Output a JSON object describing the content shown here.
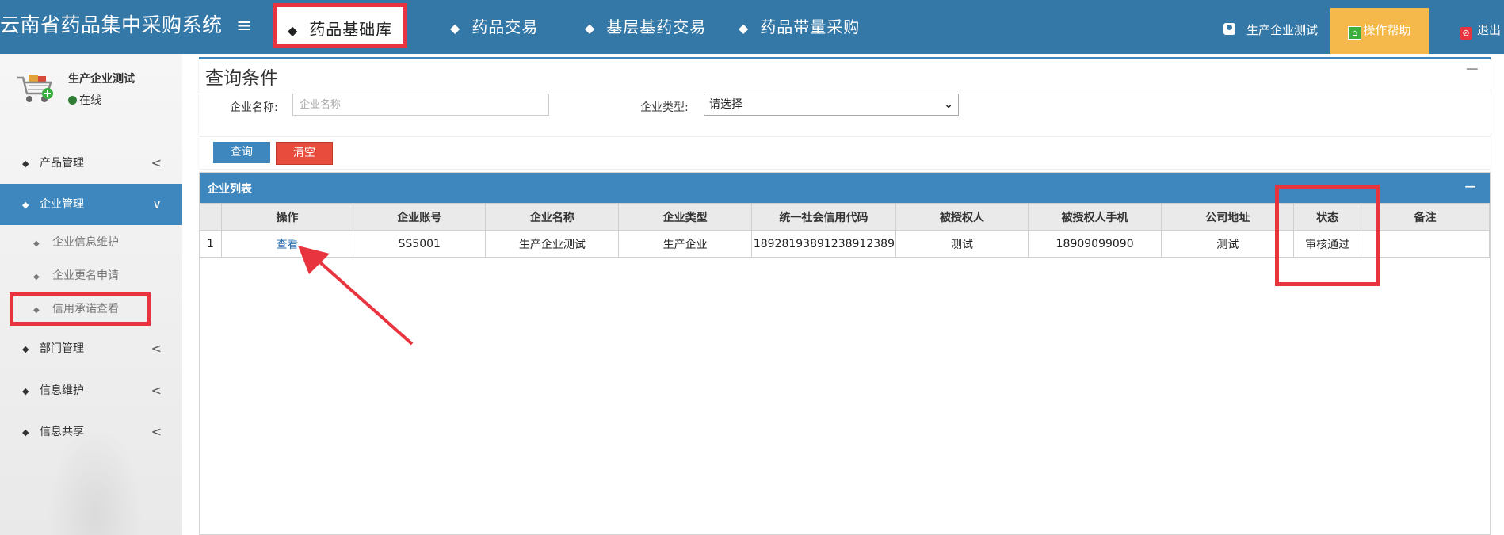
{
  "header": {
    "brand": "云南省药品集中采购系统",
    "menu_toggle": "≡",
    "nav": [
      {
        "label": "药品基础库"
      },
      {
        "label": "药品交易"
      },
      {
        "label": "基层基药交易"
      },
      {
        "label": "药品带量采购"
      }
    ],
    "user_name": "生产企业测试",
    "help_label": "操作帮助",
    "logout_label": "退出"
  },
  "sidebar": {
    "profile_name": "生产企业测试",
    "profile_status": "在线",
    "menu": [
      {
        "label": "产品管理"
      },
      {
        "label": "企业管理"
      },
      {
        "label": "部门管理"
      },
      {
        "label": "信息维护"
      },
      {
        "label": "信息共享"
      }
    ],
    "submenu": [
      {
        "label": "企业信息维护"
      },
      {
        "label": "企业更名申请"
      },
      {
        "label": "信用承诺查看"
      }
    ]
  },
  "query": {
    "title": "查询条件",
    "company_name_label": "企业名称:",
    "company_name_placeholder": "企业名称",
    "company_type_label": "企业类型:",
    "company_type_value": "请选择",
    "search_button": "查询",
    "clear_button": "清空"
  },
  "list": {
    "title": "企业列表",
    "columns": [
      "操作",
      "企业账号",
      "企业名称",
      "企业类型",
      "统一社会信用代码",
      "被授权人",
      "被授权人手机",
      "公司地址",
      "状态",
      "备注"
    ],
    "rows": [
      {
        "num": "1",
        "action": "查看",
        "account": "SS5001",
        "name": "生产企业测试",
        "type": "生产企业",
        "credit_code": "18928193891238912389",
        "authorized_person": "测试",
        "authorized_phone": "18909099090",
        "address": "测试",
        "status": "审核通过",
        "remark": ""
      }
    ]
  },
  "colors": {
    "header_bg": "#3478a8",
    "accent": "#3d87be",
    "annotation_red": "#e8343f",
    "help_bg": "#f5b94b",
    "clear_btn": "#e74c3c"
  }
}
